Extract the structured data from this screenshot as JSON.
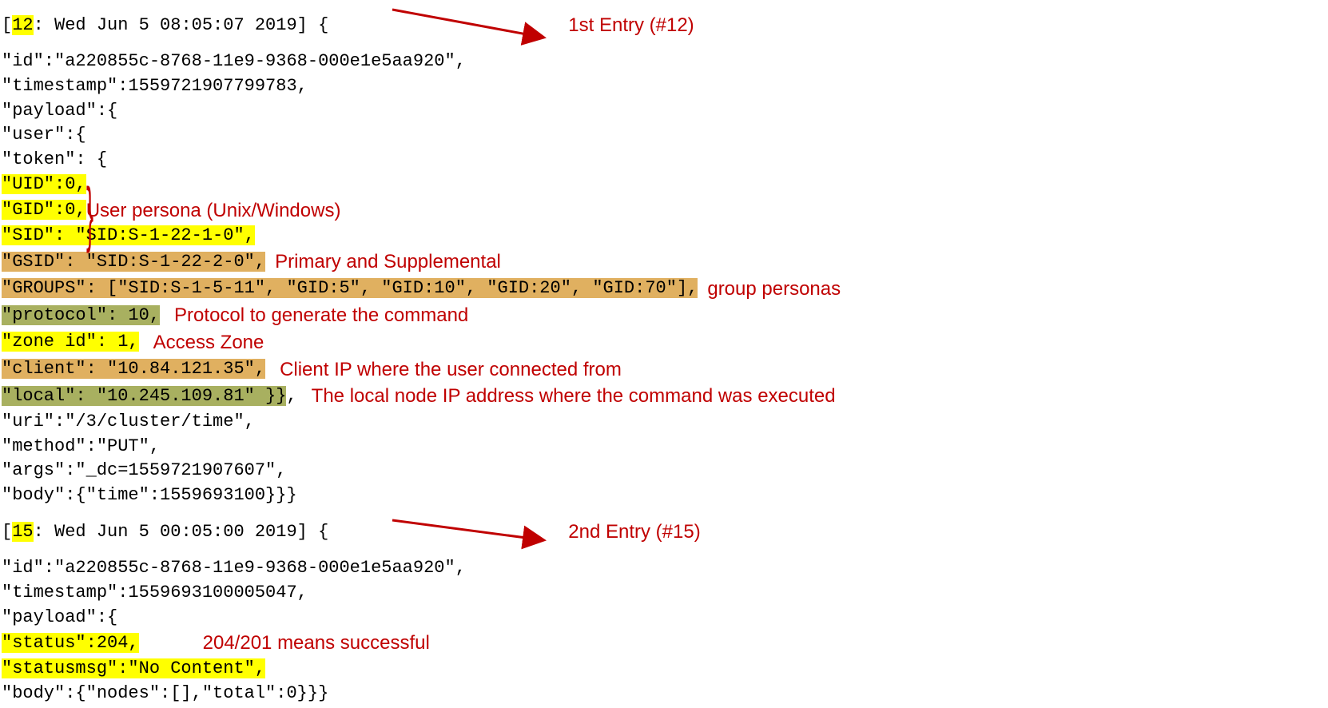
{
  "entry1": {
    "header_open": "[",
    "header_num": "12",
    "header_rest": ": Wed Jun  5 08:05:07 2019] {",
    "annot": "1st Entry (#12)",
    "id_line": "\"id\":\"a220855c-8768-11e9-9368-000e1e5aa920\",",
    "ts_line": "\"timestamp\":1559721907799783,",
    "payload_open": "\"payload\":{",
    "user_open": "     \"user\":{",
    "token_open": "          \"token\": {",
    "token_uid": "               \"UID\":0,               ",
    "token_gid": "               \"GID\":0,               ",
    "token_sid": "               \"SID\": \"SID:S-1-22-1-0\",",
    "persona_annot": "User persona (Unix/Windows)",
    "gsid_pad": "               ",
    "gsid": "\"GSID\": \"SID:S-1-22-2-0\",                                              ",
    "groups_pad": "               ",
    "groups": "\"GROUPS\": [\"SID:S-1-5-11\", \"GID:5\", \"GID:10\", \"GID:20\", \"GID:70\"],",
    "group_annot1": "Primary and Supplemental",
    "group_annot2": "group personas",
    "proto_pad": "               ",
    "proto": "\"protocol\": 10,",
    "proto_annot": "Protocol to generate the command",
    "zone_pad": "               ",
    "zone": "\"zone id\": 1,",
    "zone_annot": "Access Zone",
    "client_pad": "               ",
    "client": "\"client\": \"10.84.121.35\",",
    "client_annot": "Client IP where the user connected from",
    "local_pad": "               ",
    "local": "\"local\": \"10.245.109.81\" }}",
    "local_tail": ",",
    "local_annot": "The local node IP address where the command was executed",
    "uri": "     \"uri\":\"/3/cluster/time\",",
    "method": "     \"method\":\"PUT\",",
    "args": "     \"args\":\"_dc=1559721907607\",",
    "body": "     \"body\":{\"time\":1559693100}}}"
  },
  "entry2": {
    "header_open": "[",
    "header_num": "15",
    "header_rest": ": Wed Jun  5 00:05:00 2019] {",
    "annot": "2nd Entry (#15)",
    "id_line": "\"id\":\"a220855c-8768-11e9-9368-000e1e5aa920\",",
    "ts_line": "\"timestamp\":1559693100005047,",
    "payload_open": "\"payload\":{",
    "status_pad": "     ",
    "status": "\"status\":204,          ",
    "statusmsg_pad": "     ",
    "statusmsg": "\"statusmsg\":\"No Content\",",
    "status_annot": "204/201 means successful",
    "body": "     \"body\":{\"nodes\":[],\"total\":0}}}"
  }
}
